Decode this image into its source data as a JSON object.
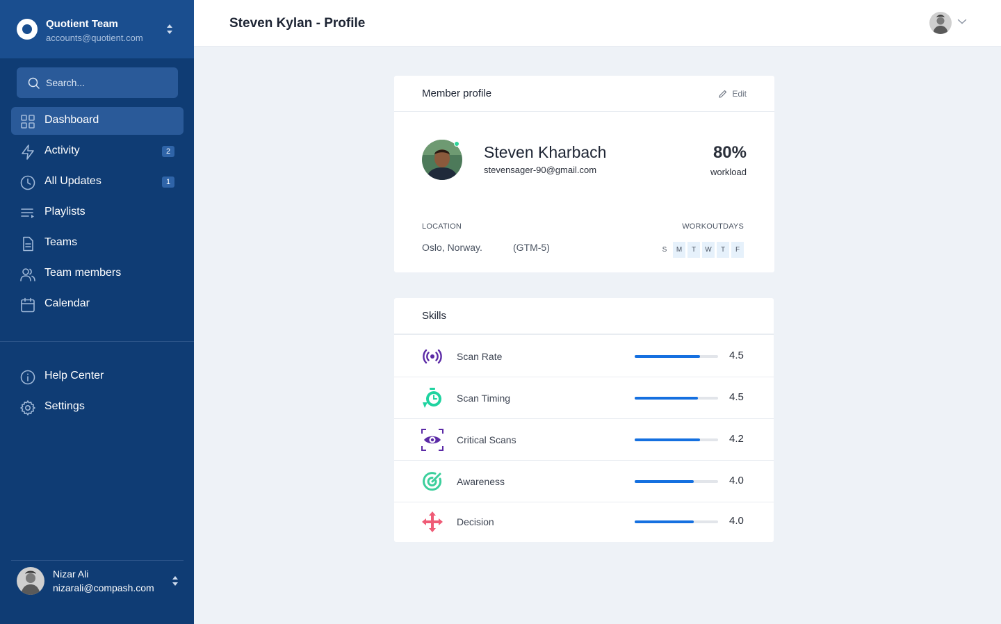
{
  "team": {
    "name": "Quotient Team",
    "email": "accounts@quotient.com"
  },
  "search": {
    "placeholder": "Search..."
  },
  "nav": [
    {
      "label": "Dashboard",
      "icon": "grid-icon",
      "active": true
    },
    {
      "label": "Activity",
      "icon": "lightning-icon",
      "badge": "2"
    },
    {
      "label": "All Updates",
      "icon": "clock-icon",
      "badge": "1"
    },
    {
      "label": "Playlists",
      "icon": "playlist-icon"
    },
    {
      "label": "Teams",
      "icon": "document-icon"
    },
    {
      "label": "Team members",
      "icon": "users-icon"
    },
    {
      "label": "Calendar",
      "icon": "calendar-icon"
    }
  ],
  "nav_bottom": [
    {
      "label": "Help Center",
      "icon": "info-icon"
    },
    {
      "label": "Settings",
      "icon": "gear-icon"
    }
  ],
  "user": {
    "name": "Nizar Ali",
    "email": "nizarali@compash.com"
  },
  "page": {
    "title": "Steven Kylan - Profile"
  },
  "profile": {
    "card_title": "Member profile",
    "edit_label": "Edit",
    "name": "Steven Kharbach",
    "email": "stevensager-90@gmail.com",
    "workload_value": "80%",
    "workload_label": "workload",
    "location_label": "LOCATION",
    "location": "Oslo, Norway.",
    "timezone": "(GTM-5)",
    "workdays_label": "WORKOUTDAYS",
    "days": [
      {
        "letter": "S",
        "on": false
      },
      {
        "letter": "M",
        "on": true
      },
      {
        "letter": "T",
        "on": true
      },
      {
        "letter": "W",
        "on": true
      },
      {
        "letter": "T",
        "on": true
      },
      {
        "letter": "F",
        "on": true
      }
    ]
  },
  "skills": {
    "title": "Skills",
    "items": [
      {
        "name": "Scan Rate",
        "value": "4.5",
        "level": 0.78,
        "icon": "broadcast-icon",
        "color": "#5b2aa6"
      },
      {
        "name": "Scan Timing",
        "value": "4.5",
        "level": 0.76,
        "icon": "stopwatch-icon",
        "color": "#1fd3a0"
      },
      {
        "name": "Critical Scans",
        "value": "4.2",
        "level": 0.78,
        "icon": "eye-scan-icon",
        "color": "#5b2aa6"
      },
      {
        "name": "Awareness",
        "value": "4.0",
        "level": 0.71,
        "icon": "target-icon",
        "color": "#3ccf9c"
      },
      {
        "name": "Decision",
        "value": "4.0",
        "level": 0.71,
        "icon": "crossroads-icon",
        "color": "#ef5b76"
      }
    ]
  },
  "colors": {
    "sidebar": "#0f3c74",
    "accent": "#1570e0",
    "online": "#2fd49a"
  }
}
